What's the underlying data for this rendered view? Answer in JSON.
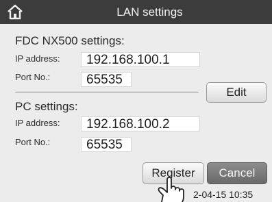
{
  "header": {
    "title": "LAN settings",
    "home_icon": "home-icon"
  },
  "fdc": {
    "title": "FDC NX500 settings:",
    "ip_label": "IP address:",
    "ip_value": "192.168.100.1",
    "port_label": "Port No.:",
    "port_value": "65535"
  },
  "pc": {
    "title": "PC settings:",
    "ip_label": "IP address:",
    "ip_value": "192.168.100.2",
    "port_label": "Port No.:",
    "port_value": "65535"
  },
  "actions": {
    "edit_label": "Edit",
    "register_label": "Register",
    "cancel_label": "Cancel"
  },
  "status": {
    "datetime": "2-04-15 10:35"
  },
  "colors": {
    "titlebar": "#3c3c3c",
    "background": "#ececec",
    "cancel_button": "#7a7a7a"
  }
}
